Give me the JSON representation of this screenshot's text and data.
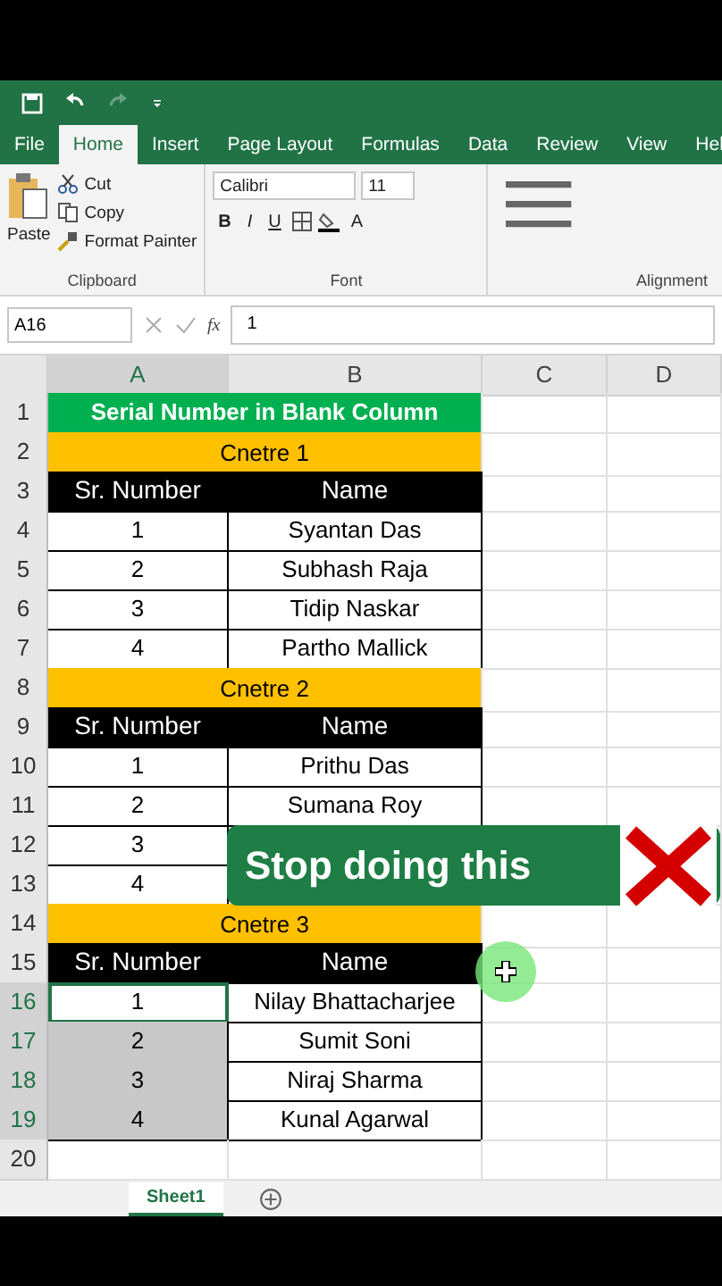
{
  "ribbon_tabs": [
    {
      "label": "File",
      "selected": false
    },
    {
      "label": "Home",
      "selected": true
    },
    {
      "label": "Insert",
      "selected": false
    },
    {
      "label": "Page Layout",
      "selected": false
    },
    {
      "label": "Formulas",
      "selected": false
    },
    {
      "label": "Data",
      "selected": false
    },
    {
      "label": "Review",
      "selected": false
    },
    {
      "label": "View",
      "selected": false
    },
    {
      "label": "Hel",
      "selected": false
    }
  ],
  "clipboard": {
    "paste": "Paste",
    "cut": "Cut",
    "copy": "Copy",
    "format_painter": "Format Painter",
    "label": "Clipboard"
  },
  "font": {
    "name": "Calibri",
    "size": "11",
    "bold": "B",
    "italic": "I",
    "underline": "U",
    "font_color": "A",
    "label": "Font"
  },
  "alignment": {
    "label": "Alignment"
  },
  "formula_bar": {
    "name_box": "A16",
    "function_label": "fx",
    "value": "1"
  },
  "columns": [
    {
      "label": "A",
      "selected": true
    },
    {
      "label": "B",
      "selected": false
    },
    {
      "label": "C",
      "selected": false
    },
    {
      "label": "D",
      "selected": false
    }
  ],
  "rows": [
    {
      "number": "1",
      "kind": "title",
      "text": "Serial Number in Blank Column"
    },
    {
      "number": "2",
      "kind": "centre",
      "text": "Cnetre 1"
    },
    {
      "number": "3",
      "kind": "header",
      "serial": "Sr. Number",
      "name": "Name"
    },
    {
      "number": "4",
      "kind": "data",
      "serial": "1",
      "name": "Syantan Das",
      "selected": false,
      "active": false
    },
    {
      "number": "5",
      "kind": "data",
      "serial": "2",
      "name": "Subhash Raja",
      "selected": false,
      "active": false
    },
    {
      "number": "6",
      "kind": "data",
      "serial": "3",
      "name": "Tidip Naskar",
      "selected": false,
      "active": false
    },
    {
      "number": "7",
      "kind": "data",
      "serial": "4",
      "name": "Partho Mallick",
      "selected": false,
      "active": false
    },
    {
      "number": "8",
      "kind": "centre",
      "text": "Cnetre 2"
    },
    {
      "number": "9",
      "kind": "header",
      "serial": "Sr. Number",
      "name": "Name"
    },
    {
      "number": "10",
      "kind": "data",
      "serial": "1",
      "name": "Prithu Das",
      "selected": false,
      "active": false
    },
    {
      "number": "11",
      "kind": "data",
      "serial": "2",
      "name": "Sumana Roy",
      "selected": false,
      "active": false
    },
    {
      "number": "12",
      "kind": "data",
      "serial": "3",
      "selected": false,
      "active": false
    },
    {
      "number": "13",
      "kind": "data",
      "serial": "4",
      "selected": false,
      "active": false
    },
    {
      "number": "14",
      "kind": "centre",
      "text": "Cnetre 3"
    },
    {
      "number": "15",
      "kind": "header",
      "serial": "Sr. Number",
      "name": "Name"
    },
    {
      "number": "16",
      "kind": "data",
      "serial": "1",
      "name": "Nilay Bhattacharjee",
      "selected": true,
      "active": true
    },
    {
      "number": "17",
      "kind": "data",
      "serial": "2",
      "name": "Sumit Soni",
      "selected": true,
      "active": false
    },
    {
      "number": "18",
      "kind": "data",
      "serial": "3",
      "name": "Niraj Sharma",
      "selected": true,
      "active": false
    },
    {
      "number": "19",
      "kind": "data",
      "serial": "4",
      "name": "Kunal Agarwal",
      "selected": true,
      "active": false
    },
    {
      "number": "20",
      "kind": "empty"
    }
  ],
  "banner": {
    "text": "Stop doing this"
  },
  "sheet_tabs": [
    {
      "label": "Sheet1",
      "selected": true
    }
  ]
}
